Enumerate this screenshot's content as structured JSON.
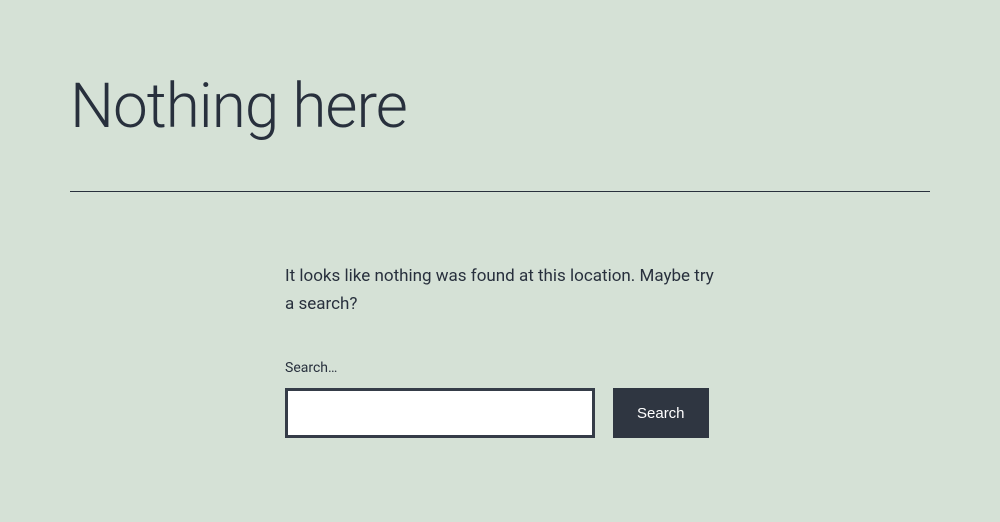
{
  "header": {
    "title": "Nothing here"
  },
  "main": {
    "message": "It looks like nothing was found at this location. Maybe try a search?"
  },
  "search": {
    "label": "Search…",
    "value": "",
    "button_label": "Search"
  }
}
